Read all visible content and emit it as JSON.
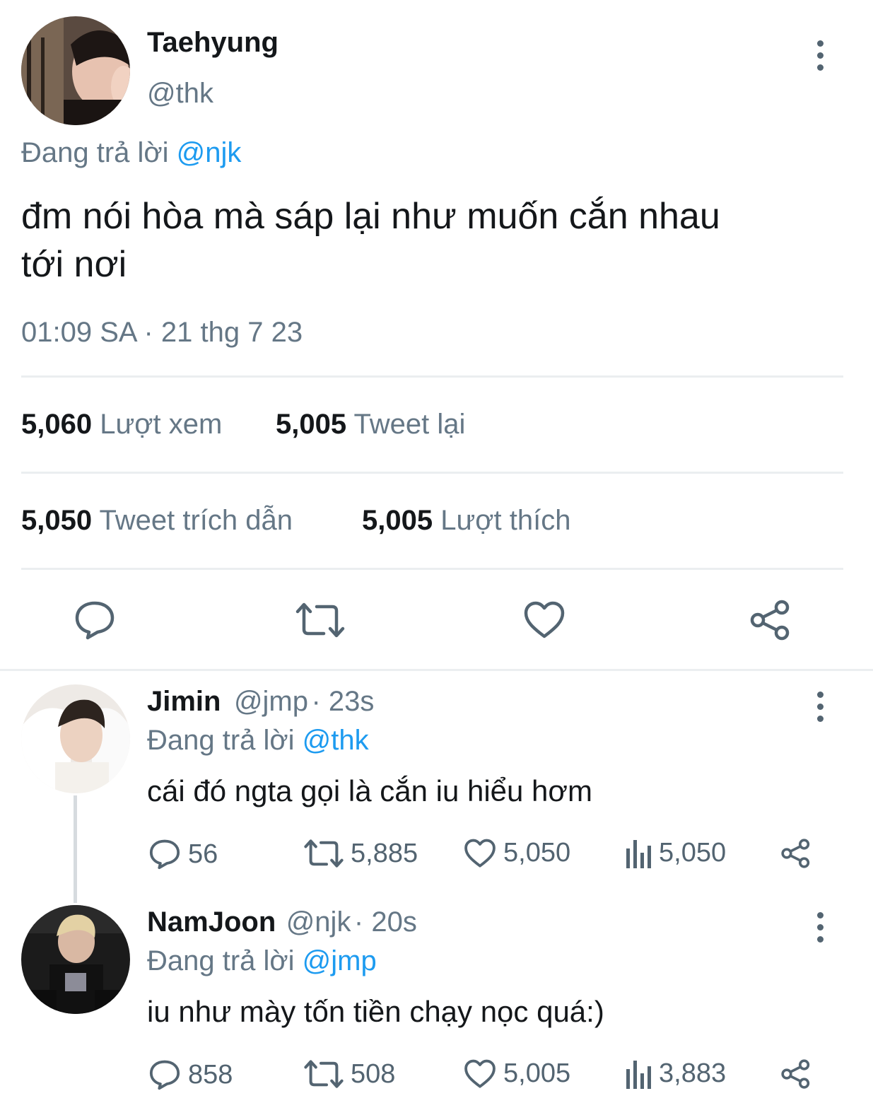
{
  "main_tweet": {
    "display_name": "Taehyung",
    "handle": "@thk",
    "replying_prefix": "Đang trả lời",
    "replying_to": "@njk",
    "text_line1": "đm nói hòa mà sáp lại như muốn cắn nhau",
    "text_line2": "tới nơi",
    "timestamp": "01:09 SA · 21 thg 7 23",
    "views_count": "5,060",
    "views_label": "Lượt xem",
    "retweets_count": "5,005",
    "retweets_label": "Tweet lại",
    "quotes_count": "5,050",
    "quotes_label": "Tweet trích dẫn",
    "likes_count": "5,005",
    "likes_label": "Lượt thích",
    "action_icons": [
      "comment-icon",
      "retweet-icon",
      "heart-icon",
      "share-icon"
    ]
  },
  "replies": [
    {
      "display_name": "Jimin",
      "handle": "@jmp",
      "time": "· 23s",
      "replying_prefix": "Đang trả lời",
      "replying_to": "@thk",
      "text": "cái đó ngta gọi là cắn iu hiểu hơm",
      "comments": "56",
      "retweets": "5,885",
      "likes": "5,050",
      "views": "5,050"
    },
    {
      "display_name": "NamJoon",
      "handle": "@njk",
      "time": "· 20s",
      "replying_prefix": "Đang trả lời",
      "replying_to": "@jmp",
      "text": "iu như mày tốn tiền chạy nọc quá:)",
      "comments": "858",
      "retweets": "508",
      "likes": "5,005",
      "views": "3,883"
    }
  ],
  "colors": {
    "link": "#1d9bf0",
    "secondary": "#657786",
    "divider": "#ebeef0"
  }
}
